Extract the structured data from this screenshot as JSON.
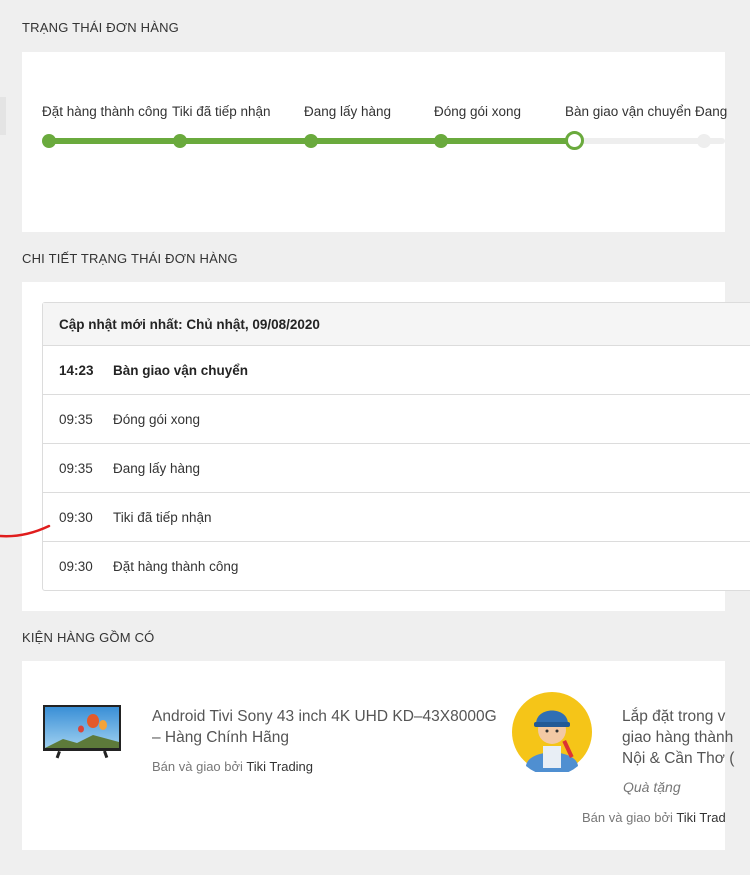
{
  "order_status": {
    "title": "TRẠNG THÁI ĐƠN HÀNG",
    "steps": [
      {
        "label": "Đặt hàng thành công",
        "state": "done"
      },
      {
        "label": "Tiki đã tiếp nhận",
        "state": "done"
      },
      {
        "label": "Đang lấy hàng",
        "state": "done"
      },
      {
        "label": "Đóng gói xong",
        "state": "done"
      },
      {
        "label": "Bàn giao vận chuyển",
        "state": "current"
      },
      {
        "label": "Đang",
        "state": "pending"
      }
    ]
  },
  "status_detail": {
    "title": "CHI TIẾT TRẠNG THÁI ĐƠN HÀNG",
    "latest_update": "Cập nhật mới nhất: Chủ nhật, 09/08/2020",
    "rows": [
      {
        "time": "14:23",
        "status": "Bàn giao vận chuyển"
      },
      {
        "time": "09:35",
        "status": "Đóng gói xong"
      },
      {
        "time": "09:35",
        "status": "Đang lấy hàng"
      },
      {
        "time": "09:30",
        "status": "Tiki đã tiếp nhận"
      },
      {
        "time": "09:30",
        "status": "Đặt hàng thành công"
      }
    ]
  },
  "package": {
    "title": "KIỆN HÀNG GỒM CÓ",
    "product": {
      "name": "Android Tivi Sony 43 inch 4K UHD KD–43X8000G – Hàng Chính Hãng",
      "seller_prefix": "Bán và giao bởi",
      "seller_name": "Tiki Trading"
    },
    "gift": {
      "name_line1": "Lắp đặt trong v",
      "name_line2": "giao hàng thành",
      "name_line3": "Nội & Cần Thơ (",
      "tag": "Quà tặng",
      "seller_prefix": "Bán và giao bởi",
      "seller_name": "Tiki Trad"
    }
  },
  "colors": {
    "progress_done": "#6aaa3d",
    "progress_pending": "#eeeeee",
    "accent_red": "#e01d1d"
  }
}
